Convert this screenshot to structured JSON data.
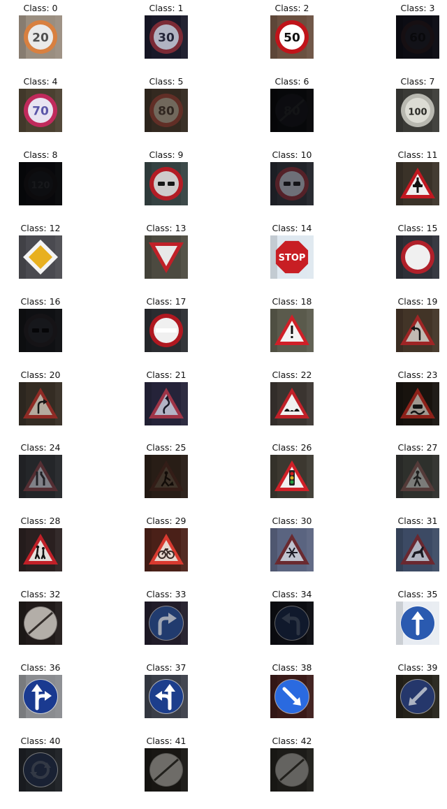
{
  "figure": {
    "title_prefix": "Class: ",
    "items": [
      {
        "label": "Class: 0",
        "class_id": 0,
        "icon": "speed-limit-20-sign-icon",
        "kind": "speed",
        "text": "20",
        "bg": "#9a8e80",
        "sign": "#d88040",
        "inner": "#eaeaea",
        "ink": "#505050",
        "dark": 0.0
      },
      {
        "label": "Class: 1",
        "class_id": 1,
        "icon": "speed-limit-30-sign-icon",
        "kind": "speed",
        "text": "30",
        "bg": "#1c1c2e",
        "sign": "#8a2f3c",
        "inner": "#c6c8d8",
        "ink": "#2a2a40",
        "dark": 0.1
      },
      {
        "label": "Class: 2",
        "class_id": 2,
        "icon": "speed-limit-50-sign-icon",
        "kind": "speed",
        "text": "50",
        "bg": "#6a5040",
        "sign": "#c0141a",
        "inner": "#ffffff",
        "ink": "#101010",
        "dark": 0.0
      },
      {
        "label": "Class: 3",
        "class_id": 3,
        "icon": "speed-limit-60-sign-icon",
        "kind": "speed",
        "text": "60",
        "bg": "#181826",
        "sign": "#2c1e24",
        "inner": "#242430",
        "ink": "#121218",
        "dark": 0.5
      },
      {
        "label": "Class: 4",
        "class_id": 4,
        "icon": "speed-limit-70-sign-icon",
        "kind": "speed",
        "text": "70",
        "bg": "#4a4030",
        "sign": "#c02a5c",
        "inner": "#e8e4f2",
        "ink": "#5a56a8",
        "dark": 0.0
      },
      {
        "label": "Class: 5",
        "class_id": 5,
        "icon": "speed-limit-80-sign-icon",
        "kind": "speed",
        "text": "80",
        "bg": "#403428",
        "sign": "#7a3a30",
        "inner": "#8e8274",
        "ink": "#3c3028",
        "dark": 0.2
      },
      {
        "label": "Class: 6",
        "class_id": 6,
        "icon": "end-speed-limit-80-sign-icon",
        "kind": "end-speed",
        "text": "80",
        "bg": "#12141a",
        "sign": "#1c1e24",
        "inner": "#1e2028",
        "ink": "#303238",
        "dark": 0.6
      },
      {
        "label": "Class: 7",
        "class_id": 7,
        "icon": "speed-limit-100-sign-icon",
        "kind": "speed",
        "text": "100",
        "bg": "#3a3a36",
        "sign": "#b8b8b0",
        "inner": "#dcdcd4",
        "ink": "#2a2a26",
        "dark": 0.0
      },
      {
        "label": "Class: 8",
        "class_id": 8,
        "icon": "speed-limit-120-sign-icon",
        "kind": "speed",
        "text": "120",
        "bg": "#14161c",
        "sign": "#201c22",
        "inner": "#22242c",
        "ink": "#3a3c44",
        "dark": 0.6
      },
      {
        "label": "Class: 9",
        "class_id": 9,
        "icon": "no-passing-sign-icon",
        "kind": "no-passing",
        "text": "",
        "bg": "#3c4a4a",
        "sign": "#c8202a",
        "inner": "#e6e2e2",
        "ink": "#1a1a1a",
        "dark": 0.1
      },
      {
        "label": "Class: 10",
        "class_id": 10,
        "icon": "no-passing-trucks-sign-icon",
        "kind": "no-passing",
        "text": "",
        "bg": "#2a2c34",
        "sign": "#6a2a32",
        "inner": "#8a8c96",
        "ink": "#1a1a1e",
        "dark": 0.2
      },
      {
        "label": "Class: 11",
        "class_id": 11,
        "icon": "right-of-way-intersection-sign-icon",
        "kind": "triangle",
        "symbol": "tree",
        "text": "",
        "bg": "#3a3228",
        "sign": "#c01820",
        "inner": "#eeeeee",
        "ink": "#111111",
        "dark": 0.0
      },
      {
        "label": "Class: 12",
        "class_id": 12,
        "icon": "priority-road-sign-icon",
        "kind": "diamond",
        "text": "",
        "bg": "#4a4a50",
        "sign": "#f4f4f4",
        "inner": "#e8b020",
        "ink": "#111111",
        "dark": 0.0
      },
      {
        "label": "Class: 13",
        "class_id": 13,
        "icon": "yield-sign-icon",
        "kind": "yield",
        "text": "",
        "bg": "#4c4a40",
        "sign": "#c02028",
        "inner": "#e8e8e8",
        "ink": "#111111",
        "dark": 0.0
      },
      {
        "label": "Class: 14",
        "class_id": 14,
        "icon": "stop-sign-icon",
        "kind": "stop",
        "text": "STOP",
        "bg": "#dfe8f0",
        "sign": "#c81e24",
        "inner": "#ffffff",
        "ink": "#ffffff",
        "dark": 0.0
      },
      {
        "label": "Class: 15",
        "class_id": 15,
        "icon": "no-vehicles-sign-icon",
        "kind": "ring",
        "text": "",
        "bg": "#2e3038",
        "sign": "#b0202a",
        "inner": "#f0f0f0",
        "ink": "#111111",
        "dark": 0.0
      },
      {
        "label": "Class: 16",
        "class_id": 16,
        "icon": "no-trucks-sign-icon",
        "kind": "no-passing",
        "text": "",
        "bg": "#1e2026",
        "sign": "#2a262c",
        "inner": "#2c2e36",
        "ink": "#0c0c10",
        "dark": 0.5
      },
      {
        "label": "Class: 17",
        "class_id": 17,
        "icon": "no-entry-sign-icon",
        "kind": "no-entry",
        "text": "",
        "bg": "#2a2c30",
        "sign": "#b01820",
        "inner": "#f0f0f0",
        "ink": "#ffffff",
        "dark": 0.0
      },
      {
        "label": "Class: 18",
        "class_id": 18,
        "icon": "general-caution-sign-icon",
        "kind": "triangle",
        "symbol": "exclaim",
        "text": "",
        "bg": "#5a5a4c",
        "sign": "#d02028",
        "inner": "#f4f4f4",
        "ink": "#111111",
        "dark": 0.0
      },
      {
        "label": "Class: 19",
        "class_id": 19,
        "icon": "dangerous-curve-left-sign-icon",
        "kind": "triangle",
        "symbol": "curve-left",
        "text": "",
        "bg": "#4a3a2c",
        "sign": "#b02a2a",
        "inner": "#d8d0c8",
        "ink": "#1a1a1a",
        "dark": 0.1
      },
      {
        "label": "Class: 20",
        "class_id": 20,
        "icon": "dangerous-curve-right-sign-icon",
        "kind": "triangle",
        "symbol": "curve-right",
        "text": "",
        "bg": "#3a3228",
        "sign": "#a0302a",
        "inner": "#c8beb0",
        "ink": "#1a1a1a",
        "dark": 0.1
      },
      {
        "label": "Class: 21",
        "class_id": 21,
        "icon": "double-curve-sign-icon",
        "kind": "triangle",
        "symbol": "double-curve",
        "text": "",
        "bg": "#2a2840",
        "sign": "#b03a50",
        "inner": "#c8c8dc",
        "ink": "#1a1a2a",
        "dark": 0.1
      },
      {
        "label": "Class: 22",
        "class_id": 22,
        "icon": "bumpy-road-sign-icon",
        "kind": "triangle",
        "symbol": "bumps",
        "text": "",
        "bg": "#3a3430",
        "sign": "#c02028",
        "inner": "#f0f0f0",
        "ink": "#111111",
        "dark": 0.0
      },
      {
        "label": "Class: 23",
        "class_id": 23,
        "icon": "slippery-road-sign-icon",
        "kind": "triangle",
        "symbol": "car",
        "text": "",
        "bg": "#1e1812",
        "sign": "#b02a20",
        "inner": "#c8beb4",
        "ink": "#1a1a1a",
        "dark": 0.2
      },
      {
        "label": "Class: 24",
        "class_id": 24,
        "icon": "road-narrows-right-sign-icon",
        "kind": "triangle",
        "symbol": "narrows",
        "text": "",
        "bg": "#2e3034",
        "sign": "#6a3a40",
        "inner": "#a0a2aa",
        "ink": "#2a2a30",
        "dark": 0.2
      },
      {
        "label": "Class: 25",
        "class_id": 25,
        "icon": "road-work-sign-icon",
        "kind": "triangle",
        "symbol": "worker",
        "text": "",
        "bg": "#3a2a20",
        "sign": "#4a2a22",
        "inner": "#5a4a3c",
        "ink": "#1a120c",
        "dark": 0.3
      },
      {
        "label": "Class: 26",
        "class_id": 26,
        "icon": "traffic-signals-sign-icon",
        "kind": "triangle",
        "symbol": "lights",
        "text": "",
        "bg": "#3c3830",
        "sign": "#d02028",
        "inner": "#f0f0f0",
        "ink": "#111111",
        "dark": 0.0
      },
      {
        "label": "Class: 27",
        "class_id": 27,
        "icon": "pedestrians-sign-icon",
        "kind": "triangle",
        "symbol": "pedestrian",
        "text": "",
        "bg": "#3a3c38",
        "sign": "#6a4a48",
        "inner": "#9a9c98",
        "ink": "#2a2a28",
        "dark": 0.2
      },
      {
        "label": "Class: 28",
        "class_id": 28,
        "icon": "children-crossing-sign-icon",
        "kind": "triangle",
        "symbol": "children",
        "text": "",
        "bg": "#2a2020",
        "sign": "#c02028",
        "inner": "#e4e0dc",
        "ink": "#111111",
        "dark": 0.0
      },
      {
        "label": "Class: 29",
        "class_id": 29,
        "icon": "bicycles-crossing-sign-icon",
        "kind": "triangle",
        "symbol": "bicycle",
        "text": "",
        "bg": "#4a2018",
        "sign": "#d83a30",
        "inner": "#e8d8d0",
        "ink": "#3a2a26",
        "dark": 0.0
      },
      {
        "label": "Class: 30",
        "class_id": 30,
        "icon": "beware-ice-snow-sign-icon",
        "kind": "triangle",
        "symbol": "snow",
        "text": "",
        "bg": "#5a6480",
        "sign": "#6a2a30",
        "inner": "#c0c4d0",
        "ink": "#1a1a24",
        "dark": 0.0
      },
      {
        "label": "Class: 31",
        "class_id": 31,
        "icon": "wild-animals-crossing-sign-icon",
        "kind": "triangle",
        "symbol": "deer",
        "text": "",
        "bg": "#3c4a64",
        "sign": "#6a2830",
        "inner": "#b0b4c0",
        "ink": "#1a1a22",
        "dark": 0.0
      },
      {
        "label": "Class: 32",
        "class_id": 32,
        "icon": "end-of-limits-sign-icon",
        "kind": "end-limits",
        "text": "",
        "bg": "#241e1c",
        "sign": "#8a8480",
        "inner": "#c8c2bc",
        "ink": "#3a3430",
        "dark": 0.1
      },
      {
        "label": "Class: 33",
        "class_id": 33,
        "icon": "turn-right-ahead-sign-icon",
        "kind": "blue-arrow",
        "arrow": "turn-right",
        "text": "",
        "bg": "#2a2434",
        "sign": "#2a4a8a",
        "inner": "#2a4a8a",
        "ink": "#c8d0e0",
        "dark": 0.2
      },
      {
        "label": "Class: 34",
        "class_id": 34,
        "icon": "turn-left-ahead-sign-icon",
        "kind": "blue-arrow",
        "arrow": "turn-left",
        "text": "",
        "bg": "#14161e",
        "sign": "#1c2a4a",
        "inner": "#1c2a4a",
        "ink": "#4a5870",
        "dark": 0.4
      },
      {
        "label": "Class: 35",
        "class_id": 35,
        "icon": "ahead-only-sign-icon",
        "kind": "blue-arrow",
        "arrow": "up",
        "text": "",
        "bg": "#e8ecf2",
        "sign": "#2a5ab0",
        "inner": "#2a5ab0",
        "ink": "#ffffff",
        "dark": 0.0
      },
      {
        "label": "Class: 36",
        "class_id": 36,
        "icon": "go-straight-or-right-sign-icon",
        "kind": "blue-arrow",
        "arrow": "straight-right",
        "text": "",
        "bg": "#8a8c90",
        "sign": "#1a3a90",
        "inner": "#1a3a90",
        "ink": "#ffffff",
        "dark": 0.0
      },
      {
        "label": "Class: 37",
        "class_id": 37,
        "icon": "go-straight-or-left-sign-icon",
        "kind": "blue-arrow",
        "arrow": "straight-left",
        "text": "",
        "bg": "#3a3e48",
        "sign": "#1c3e8c",
        "inner": "#1c3e8c",
        "ink": "#ffffff",
        "dark": 0.0
      },
      {
        "label": "Class: 38",
        "class_id": 38,
        "icon": "keep-right-sign-icon",
        "kind": "blue-arrow",
        "arrow": "keep-right",
        "text": "",
        "bg": "#3a1a18",
        "sign": "#2a6ae0",
        "inner": "#2a6ae0",
        "ink": "#ffffff",
        "dark": 0.0
      },
      {
        "label": "Class: 39",
        "class_id": 39,
        "icon": "keep-left-sign-icon",
        "kind": "blue-arrow",
        "arrow": "keep-left",
        "text": "",
        "bg": "#2a261e",
        "sign": "#2a3e78",
        "inner": "#2a3e78",
        "ink": "#c0c8d8",
        "dark": 0.1
      },
      {
        "label": "Class: 40",
        "class_id": 40,
        "icon": "roundabout-mandatory-sign-icon",
        "kind": "blue-arrow",
        "arrow": "roundabout",
        "text": "",
        "bg": "#2a2e34",
        "sign": "#24304a",
        "inner": "#24304a",
        "ink": "#4a5264",
        "dark": 0.3
      },
      {
        "label": "Class: 41",
        "class_id": 41,
        "icon": "end-of-no-passing-sign-icon",
        "kind": "end-limits",
        "text": "",
        "bg": "#1e1c18",
        "sign": "#6a6864",
        "inner": "#8a8882",
        "ink": "#2a2824",
        "dark": 0.2
      },
      {
        "label": "Class: 42",
        "class_id": 42,
        "icon": "end-no-passing-trucks-sign-icon",
        "kind": "end-limits",
        "text": "",
        "bg": "#24221e",
        "sign": "#6a6864",
        "inner": "#7e7c78",
        "ink": "#2a2824",
        "dark": 0.2
      }
    ]
  }
}
